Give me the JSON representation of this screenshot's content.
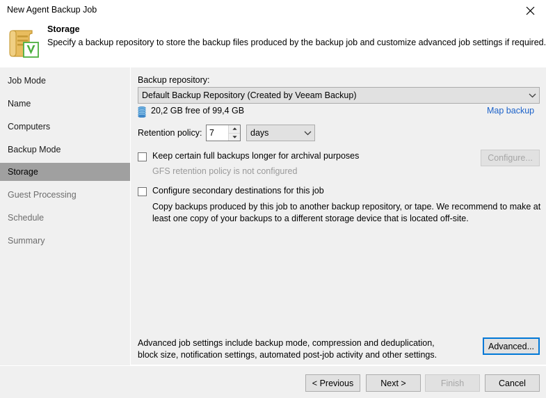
{
  "window": {
    "title": "New Agent Backup Job",
    "close_icon": "close-icon"
  },
  "header": {
    "icon": "veeam-agent-job-icon",
    "title": "Storage",
    "description": "Specify a backup repository to store the backup files produced by the backup job and customize advanced job settings if required."
  },
  "sidebar": {
    "items": [
      {
        "label": "Job Mode",
        "state": "normal"
      },
      {
        "label": "Name",
        "state": "normal"
      },
      {
        "label": "Computers",
        "state": "normal"
      },
      {
        "label": "Backup Mode",
        "state": "normal"
      },
      {
        "label": "Storage",
        "state": "selected"
      },
      {
        "label": "Guest Processing",
        "state": "dim"
      },
      {
        "label": "Schedule",
        "state": "dim"
      },
      {
        "label": "Summary",
        "state": "dim"
      }
    ]
  },
  "main": {
    "repository_label": "Backup repository:",
    "repository_value": "Default Backup Repository (Created by Veeam Backup)",
    "repository_icon": "database-icon",
    "free_space_text": "20,2 GB free of 99,4 GB",
    "map_backup_link": "Map backup",
    "retention_label": "Retention policy:",
    "retention_value": "7",
    "retention_unit": "days",
    "gfs_checkbox_label": "Keep certain full backups longer for archival purposes",
    "gfs_checkbox_checked": false,
    "gfs_note": "GFS retention policy is not configured",
    "configure_button": "Configure...",
    "configure_enabled": false,
    "secondary_checkbox_label": "Configure secondary destinations for this job",
    "secondary_checkbox_checked": false,
    "secondary_desc_line1": "Copy backups produced by this job to another backup repository, or tape. We recommend to make at",
    "secondary_desc_line2": "least one copy of your backups to a different storage device that is located off-site.",
    "advanced_desc_line1": "Advanced job settings include backup mode, compression and deduplication,",
    "advanced_desc_line2": "block size, notification settings, automated post-job activity and other settings.",
    "advanced_button": "Advanced..."
  },
  "footer": {
    "previous_button": "< Previous",
    "next_button": "Next >",
    "finish_button": "Finish",
    "finish_enabled": false,
    "cancel_button": "Cancel"
  },
  "colors": {
    "accent_blue": "#0078d7",
    "link_blue": "#1c62c9",
    "selection_gray": "#a0a0a0",
    "panel_gray": "#f0f0f0",
    "control_gray": "#e1e1e1",
    "disabled_text": "#a6a6a6",
    "icon_gold": "#e0b84f",
    "icon_green": "#4caf3f",
    "db_blue": "#3f87c8"
  }
}
